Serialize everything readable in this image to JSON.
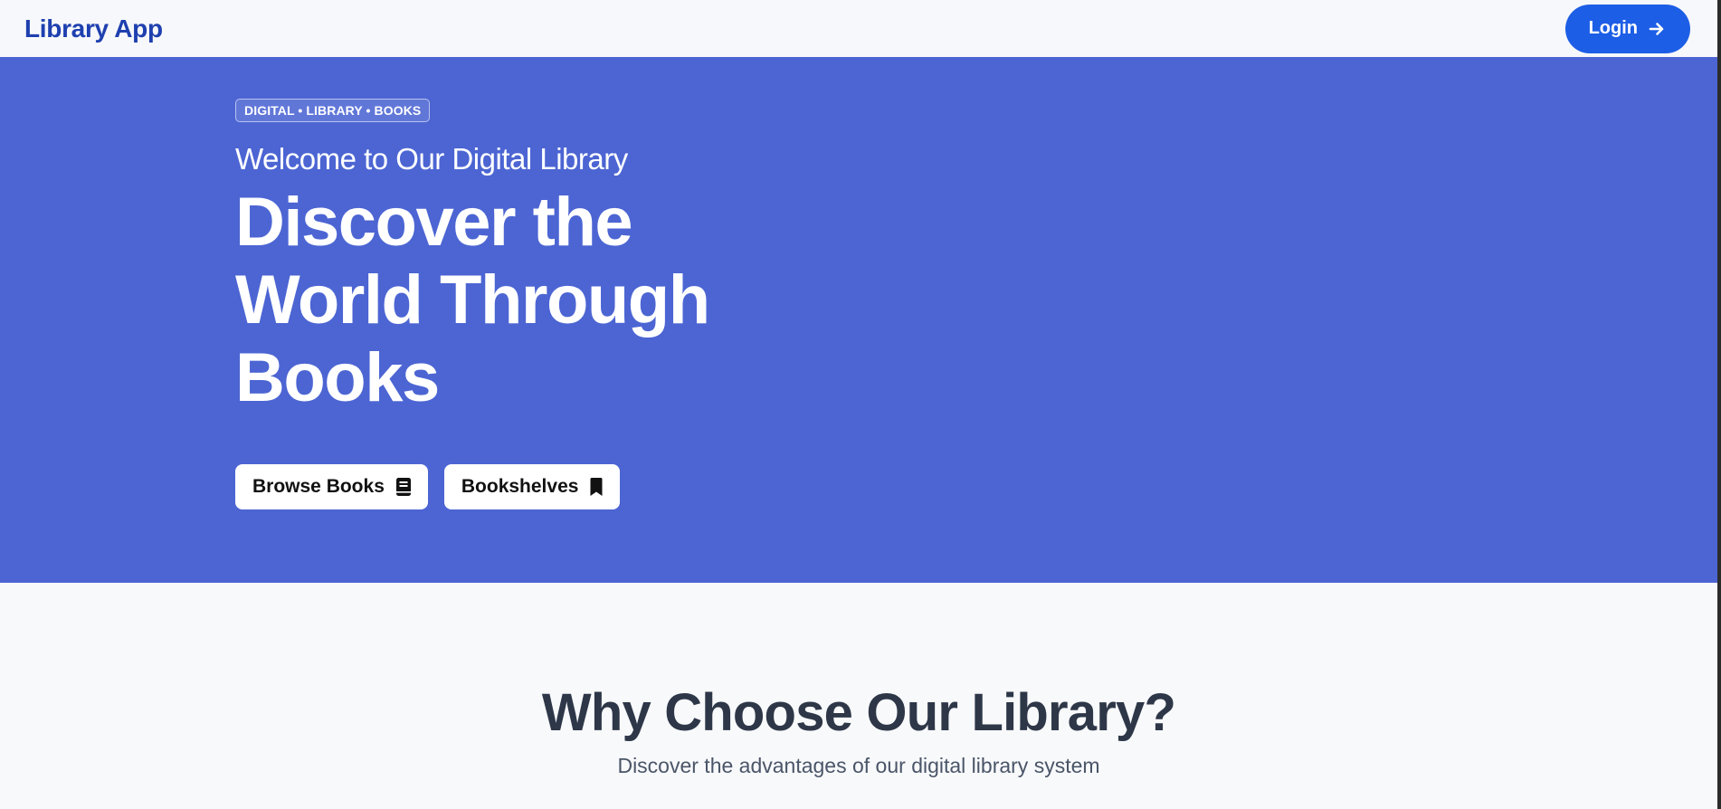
{
  "navbar": {
    "brand": "Library App",
    "login_label": "Login",
    "login_icon": "arrow-right-icon"
  },
  "hero": {
    "tag": "DIGITAL • LIBRARY • BOOKS",
    "welcome": "Welcome to Our Digital Library",
    "headline": "Discover the World Through Books",
    "buttons": [
      {
        "label": "Browse Books",
        "icon": "book-icon"
      },
      {
        "label": "Bookshelves",
        "icon": "bookmark-icon"
      }
    ]
  },
  "features": {
    "title": "Why Choose Our Library?",
    "subtitle": "Discover the advantages of our digital library system"
  },
  "colors": {
    "brand": "#1e40af",
    "login_bg": "#1d5ee6",
    "hero_bg": "#4c65d3",
    "heading_dark": "#2d3748",
    "page_bg": "#f8f9fb"
  }
}
